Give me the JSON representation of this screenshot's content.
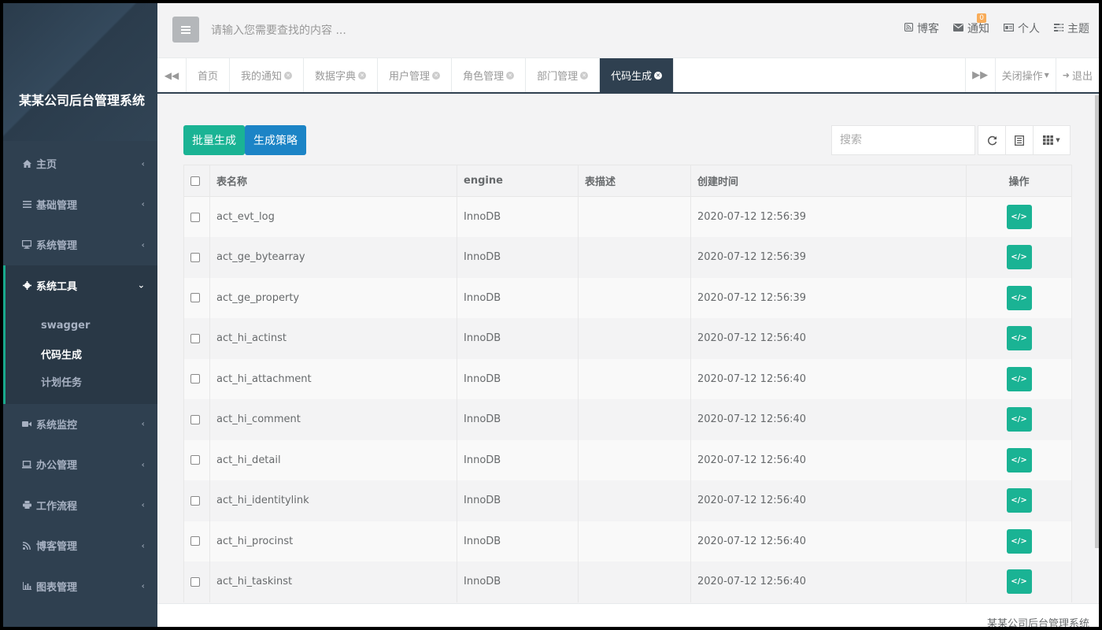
{
  "app": {
    "brand": "某某公司后台管理系统"
  },
  "colors": {
    "sidebar": "#2f4050",
    "accent_green": "#1ab394",
    "accent_blue": "#1c84c6",
    "badge": "#f8ac59"
  },
  "sidebar": {
    "items": [
      {
        "label": "主页",
        "icon": "home-icon"
      },
      {
        "label": "基础管理",
        "icon": "list-icon"
      },
      {
        "label": "系统管理",
        "icon": "desktop-icon"
      },
      {
        "label": "系统工具",
        "icon": "gear-icon"
      },
      {
        "label": "系统监控",
        "icon": "video-camera-icon"
      },
      {
        "label": "办公管理",
        "icon": "laptop-icon"
      },
      {
        "label": "工作流程",
        "icon": "print-icon"
      },
      {
        "label": "博客管理",
        "icon": "rss-icon"
      },
      {
        "label": "图表管理",
        "icon": "bar-chart-icon"
      }
    ],
    "sub_items": [
      "swagger",
      "代码生成",
      "计划任务"
    ]
  },
  "topbar": {
    "search_placeholder": "请输入您需要查找的内容 ...",
    "links": {
      "blog": "博客",
      "notify": "通知",
      "notify_badge": "0",
      "personal": "个人",
      "theme": "主题"
    }
  },
  "tabs": {
    "items": [
      "首页",
      "我的通知",
      "数据字典",
      "用户管理",
      "角色管理",
      "部门管理",
      "代码生成"
    ],
    "close_ops": "关闭操作",
    "logout": "退出"
  },
  "toolbar": {
    "batch_generate": "批量生成",
    "strategy": "生成策略",
    "search_placeholder": "搜索"
  },
  "table": {
    "headers": {
      "name": "表名称",
      "engine": "engine",
      "desc": "表描述",
      "created": "创建时间",
      "ops": "操作"
    },
    "rows": [
      {
        "name": "act_evt_log",
        "engine": "InnoDB",
        "desc": "",
        "created": "2020-07-12 12:56:39"
      },
      {
        "name": "act_ge_bytearray",
        "engine": "InnoDB",
        "desc": "",
        "created": "2020-07-12 12:56:39"
      },
      {
        "name": "act_ge_property",
        "engine": "InnoDB",
        "desc": "",
        "created": "2020-07-12 12:56:39"
      },
      {
        "name": "act_hi_actinst",
        "engine": "InnoDB",
        "desc": "",
        "created": "2020-07-12 12:56:40"
      },
      {
        "name": "act_hi_attachment",
        "engine": "InnoDB",
        "desc": "",
        "created": "2020-07-12 12:56:40"
      },
      {
        "name": "act_hi_comment",
        "engine": "InnoDB",
        "desc": "",
        "created": "2020-07-12 12:56:40"
      },
      {
        "name": "act_hi_detail",
        "engine": "InnoDB",
        "desc": "",
        "created": "2020-07-12 12:56:40"
      },
      {
        "name": "act_hi_identitylink",
        "engine": "InnoDB",
        "desc": "",
        "created": "2020-07-12 12:56:40"
      },
      {
        "name": "act_hi_procinst",
        "engine": "InnoDB",
        "desc": "",
        "created": "2020-07-12 12:56:40"
      },
      {
        "name": "act_hi_taskinst",
        "engine": "InnoDB",
        "desc": "",
        "created": "2020-07-12 12:56:40"
      }
    ]
  },
  "footer": {
    "text": "某某公司后台管理系统"
  }
}
